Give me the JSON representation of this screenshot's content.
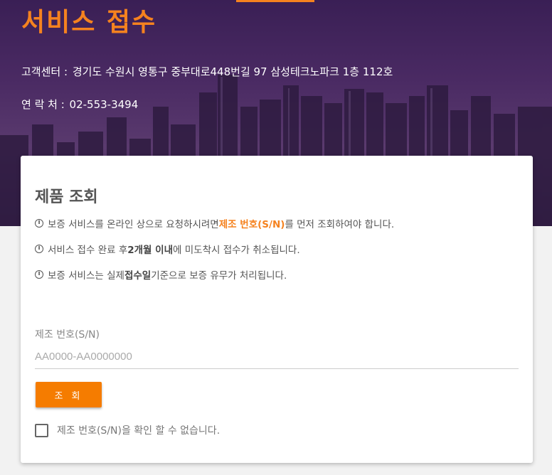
{
  "header": {
    "title": "서비스 접수",
    "address_label": "고객센터 :",
    "address_value": "경기도 수원시 영통구 중부대로448번길 97 삼성테크노파크 1층 112호",
    "contact_label": "연 락 처 :",
    "contact_value": "02-553-3494"
  },
  "card": {
    "title": "제품 조회",
    "notices": [
      {
        "before": "보증 서비스를 온라인 상으로 요청하시려면 ",
        "highlight": "제조 번호(S/N)",
        "after": "를 먼저 조회하여야 합니다."
      },
      {
        "before": "서비스 접수 완료 후 ",
        "highlight": "2개월 이내",
        "after": "에 미도착시 접수가 취소됩니다."
      },
      {
        "before": "보증 서비스는 실제 ",
        "highlight": "접수일",
        "after": " 기준으로 보증 유무가 처리됩니다."
      }
    ],
    "serial_label": "제조 번호(S/N)",
    "serial_placeholder": "AA0000-AA0000000",
    "serial_value": "",
    "search_button": "조 회",
    "unknown_serial_label": "제조 번호(S/N)을 확인 할 수 없습니다."
  },
  "colors": {
    "accent": "#f5821f",
    "button": "#f57c00",
    "hero_bg": "#4a2a63"
  },
  "icons": [
    "info-icon",
    "checkbox-icon"
  ]
}
